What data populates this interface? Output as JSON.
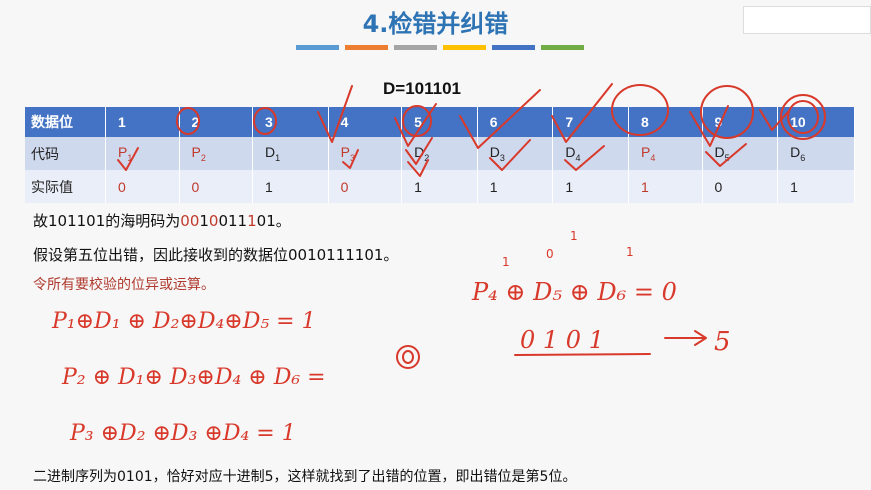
{
  "title": "4.检错并纠错",
  "color_bar": [
    "#5b9bd5",
    "#ed7d31",
    "#a5a5a5",
    "#ffc000",
    "#4472c4",
    "#70ad47"
  ],
  "d_value": "D=101101",
  "table": {
    "row_headers": [
      "数据位",
      "代码",
      "实际值"
    ],
    "positions": [
      "1",
      "2",
      "3",
      "4",
      "5",
      "6",
      "7",
      "8",
      "9",
      "10"
    ],
    "codes": [
      {
        "letter": "P",
        "sub": "1",
        "red": true
      },
      {
        "letter": "P",
        "sub": "2",
        "red": true
      },
      {
        "letter": "D",
        "sub": "1",
        "red": false
      },
      {
        "letter": "P",
        "sub": "3",
        "red": true
      },
      {
        "letter": "D",
        "sub": "2",
        "red": false
      },
      {
        "letter": "D",
        "sub": "3",
        "red": false
      },
      {
        "letter": "D",
        "sub": "4",
        "red": false
      },
      {
        "letter": "P",
        "sub": "4",
        "red": true
      },
      {
        "letter": "D",
        "sub": "5",
        "red": false
      },
      {
        "letter": "D",
        "sub": "6",
        "red": false
      }
    ],
    "actual": [
      {
        "v": "0",
        "red": true
      },
      {
        "v": "0",
        "red": true
      },
      {
        "v": "1",
        "red": false
      },
      {
        "v": "0",
        "red": true
      },
      {
        "v": "1",
        "red": false
      },
      {
        "v": "1",
        "red": false
      },
      {
        "v": "1",
        "red": false
      },
      {
        "v": "1",
        "red": true
      },
      {
        "v": "0",
        "red": false
      },
      {
        "v": "1",
        "red": false
      }
    ]
  },
  "line1_pre": "故101101的海明码为",
  "line1_code": "0010011101",
  "line1_post": "。",
  "line2": "假设第五位出错，因此接收到的数据位0010111101。",
  "line3": "令所有要校验的位异或运算。",
  "bottom": "二进制序列为0101，恰好对应十进制5，这样就找到了出错的位置，即出错位是第5位。",
  "handwriting_color": "#d8392b"
}
